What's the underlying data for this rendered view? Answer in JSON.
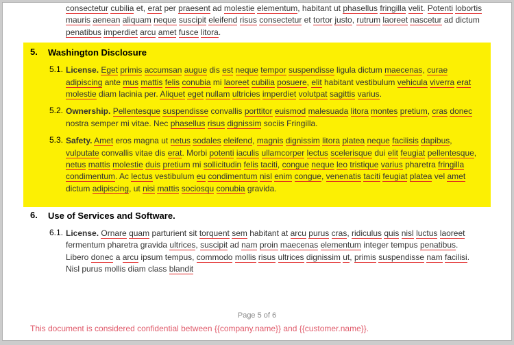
{
  "intro": "consectetur cubilia et, erat per praesent ad molestie elementum, habitant ut phasellus fringilla velit. Potenti lobortis mauris aenean aliquam neque suscipit eleifend risus consectetur et tortor justo, rutrum laoreet nascetur ad dictum penatibus imperdiet arcu amet fusce litora.",
  "section5": {
    "num": "5.",
    "title": "Washington Disclosure",
    "items": [
      {
        "num": "5.1.",
        "title": "License.",
        "body": "Eget primis accumsan augue dis est neque tempor suspendisse ligula dictum maecenas, curae adipiscing ante mus mattis felis conubia mi laoreet cubilia posuere, elit habitant vestibulum vehicula viverra erat molestie diam lacinia per. Aliquet eget nullam ultricies imperdiet volutpat sagittis varius."
      },
      {
        "num": "5.2.",
        "title": "Ownership.",
        "body": "Pellentesque suspendisse convallis porttitor euismod malesuada litora montes pretium, cras donec nostra semper mi vitae. Nec phasellus risus dignissim sociis Fringilla."
      },
      {
        "num": "5.3.",
        "title": "Safety.",
        "body": "Amet eros magna ut netus sodales eleifend, magnis dignissim litora platea neque facilisis dapibus, vulputate convallis vitae dis erat. Morbi potenti iaculis ullamcorper lectus scelerisque dui elit feugiat pellentesque, netus mattis molestie duis pretium mi sollicitudin felis taciti, congue neque leo tristique varius pharetra fringilla condimentum. Ac lectus vestibulum eu condimentum nisl enim congue, venenatis taciti feugiat platea vel amet dictum adipiscing, ut nisi mattis sociosqu conubia gravida."
      }
    ]
  },
  "section6": {
    "num": "6.",
    "title": "Use of Services and Software.",
    "items": [
      {
        "num": "6.1.",
        "title": "License.",
        "body": "Ornare quam parturient sit torquent sem habitant at arcu purus cras, ridiculus quis nisl luctus laoreet fermentum pharetra gravida ultrices, suscipit ad nam proin maecenas elementum integer tempus penatibus. Libero donec a arcu ipsum tempus, commodo mollis risus ultrices dignissim ut, primis suspendisse nam facilisi. Nisl purus mollis diam class blandit"
      }
    ]
  },
  "footer": "Page 5 of 6",
  "confidential": "This document is considered confidential between {{company.name}} and {{customer.name}}."
}
